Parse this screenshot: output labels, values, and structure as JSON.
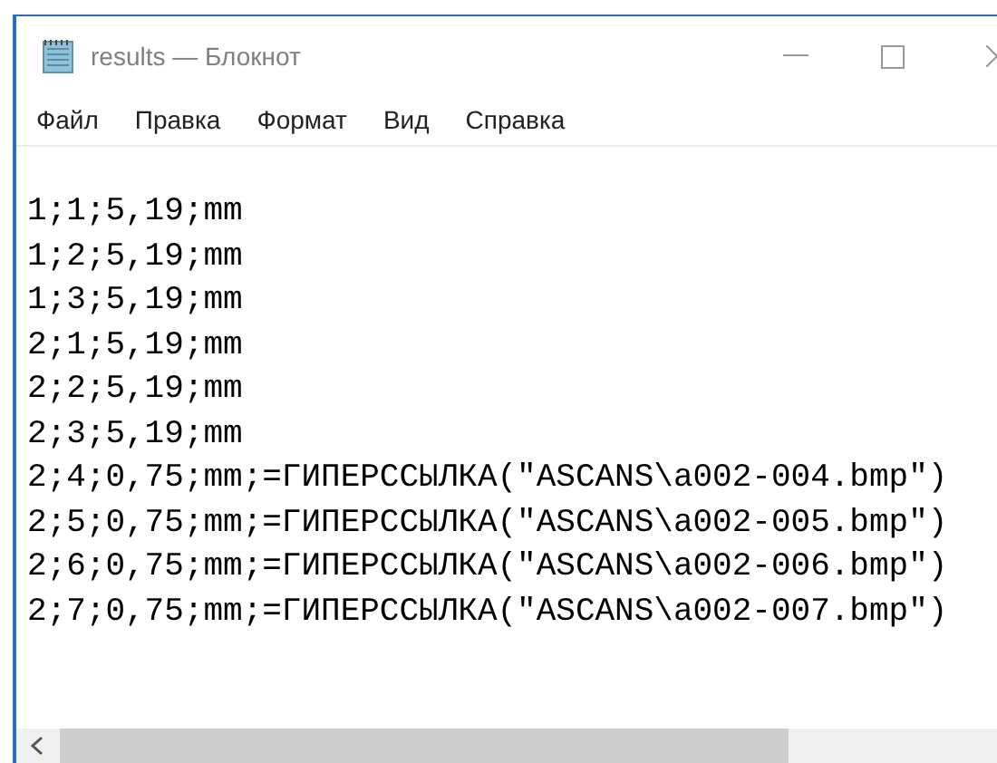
{
  "window": {
    "title": "results — Блокнот"
  },
  "menu": [
    "Файл",
    "Правка",
    "Формат",
    "Вид",
    "Справка"
  ],
  "editor": {
    "lines": [
      "1;1;5,19;mm",
      "1;2;5,19;mm",
      "1;3;5,19;mm",
      "2;1;5,19;mm",
      "2;2;5,19;mm",
      "2;3;5,19;mm",
      "2;4;0,75;mm;=ГИПЕРССЫЛКА(\"ASCANS\\a002-004.bmp\")",
      "2;5;0,75;mm;=ГИПЕРССЫЛКА(\"ASCANS\\a002-005.bmp\")",
      "2;6;0,75;mm;=ГИПЕРССЫЛКА(\"ASCANS\\a002-006.bmp\")",
      "2;7;0,75;mm;=ГИПЕРССЫЛКА(\"ASCANS\\a002-007.bmp\")"
    ]
  }
}
